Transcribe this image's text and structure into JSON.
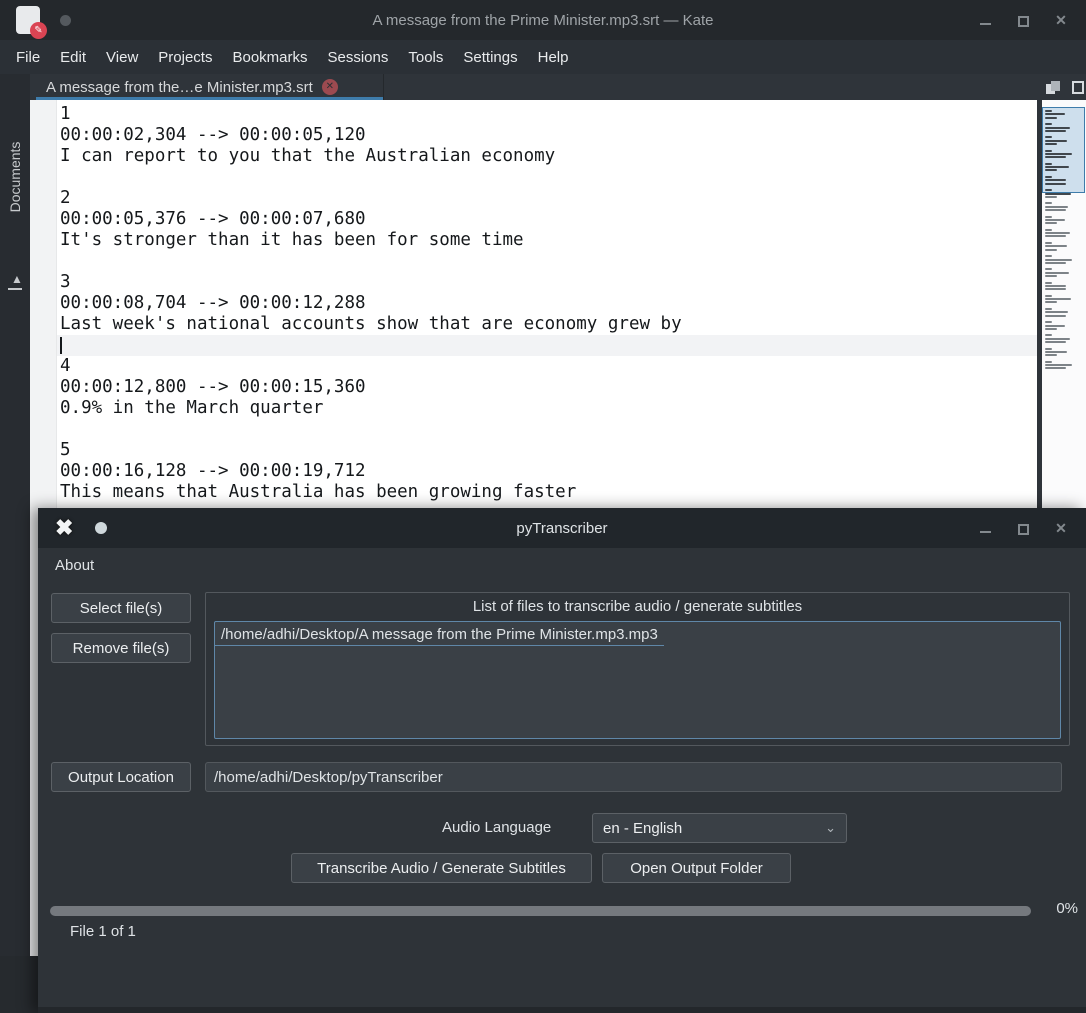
{
  "kate": {
    "titlebar": {
      "title": "A message from the Prime Minister.mp3.srt — Kate"
    },
    "menu": [
      "File",
      "Edit",
      "View",
      "Projects",
      "Bookmarks",
      "Sessions",
      "Tools",
      "Settings",
      "Help"
    ],
    "tab": {
      "label": "A message from the…e Minister.mp3.srt"
    },
    "dock": {
      "label": "Documents"
    },
    "editor": {
      "lines": [
        "1",
        "00:00:02,304 --> 00:00:05,120",
        "I can report to you that the Australian economy",
        "",
        "2",
        "00:00:05,376 --> 00:00:07,680",
        "It's stronger than it has been for some time",
        "",
        "3",
        "00:00:08,704 --> 00:00:12,288",
        "Last week's national accounts show that are economy grew by",
        "",
        "4",
        "00:00:12,800 --> 00:00:15,360",
        "0.9% in the March quarter",
        "",
        "5",
        "00:00:16,128 --> 00:00:19,712",
        "This means that Australia has been growing faster"
      ],
      "cursor_line_index": 11
    }
  },
  "pytranscriber": {
    "titlebar": {
      "title": "pyTranscriber"
    },
    "menu": [
      "About"
    ],
    "buttons": {
      "select": "Select file(s)",
      "remove": "Remove file(s)",
      "output_location": "Output Location",
      "transcribe": "Transcribe Audio / Generate Subtitles",
      "open_output": "Open Output Folder"
    },
    "group_title": "List of files to transcribe audio / generate subtitles",
    "file_list": [
      "/home/adhi/Desktop/A message from the Prime Minister.mp3.mp3"
    ],
    "output_path": "/home/adhi/Desktop/pyTranscriber",
    "audio_language_label": "Audio Language",
    "audio_language_value": "en - English",
    "progress": {
      "percent": "0%",
      "status": "File 1 of 1"
    }
  },
  "icons": {
    "close": "✕",
    "pencil": "✎",
    "chevron_down": "⌄",
    "arrow_up": "▲",
    "app_x": "✖"
  },
  "colors": {
    "accent_blue": "#3e7cab",
    "focus_border": "#5f87a8",
    "close_badge_red": "#9c4a50",
    "kate_badge_red": "#da4453",
    "editor_bg": "#ffffff",
    "dark_bg": "#2e3338"
  }
}
